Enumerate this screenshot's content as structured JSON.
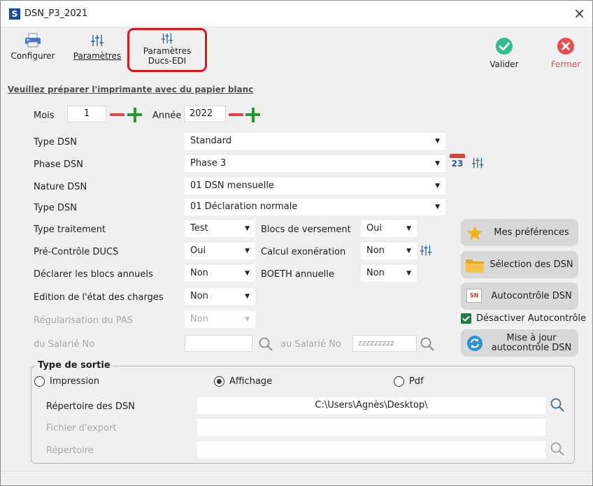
{
  "window": {
    "title": "DSN_P3_2021",
    "app_letter": "S",
    "close": "×"
  },
  "toolbar": {
    "configurer": "Configurer",
    "parametres": "Paramètres",
    "parametres_ducs_line1": "Paramètres",
    "parametres_ducs_line2": "Ducs-EDI",
    "valider": "Valider",
    "fermer": "Fermer"
  },
  "notice": "Veuillez préparer l'imprimante avec du papier blanc",
  "period": {
    "mois_label": "Mois",
    "mois": "1",
    "annee_label": "Année",
    "annee": "2022"
  },
  "fields": {
    "type_dsn_label": "Type DSN",
    "type_dsn": "Standard",
    "phase_dsn_label": "Phase DSN",
    "phase_dsn": "Phase 3",
    "calendar_day": "23",
    "nature_dsn_label": "Nature DSN",
    "nature_dsn": "01 DSN mensuelle",
    "type_dsn2_label": "Type DSN",
    "type_dsn2": "01 Déclaration normale",
    "type_traitement_label": "Type traitement",
    "type_traitement": "Test",
    "blocs_versement_label": "Blocs de versement",
    "blocs_versement": "Oui",
    "pre_controle_label": "Pré-Contrôle DUCS",
    "pre_controle": "Oui",
    "calcul_exo_label": "Calcul exonération",
    "calcul_exo": "Non",
    "blocs_annuels_label": "Déclarer les blocs annuels",
    "blocs_annuels": "Non",
    "boeth_label": "BOETH annuelle",
    "boeth": "Non",
    "edition_label": "Edition de l'état des charges",
    "edition": "Non",
    "regul_pas_label": "Régularisation du PAS",
    "regul_pas": "Non",
    "du_salarie_label": "du Salarié No",
    "du_salarie": "",
    "au_salarie_label": "au Salarié No",
    "au_salarie": "zzzzzzzzz"
  },
  "side": {
    "mes_preferences": "Mes préférences",
    "selection_dsn": "Sélection des DSN",
    "autocontrole": "Autocontrôle DSN",
    "desactiver": "Désactiver Autocontrôle",
    "maj_line1": "Mise à jour",
    "maj_line2": "autocontrôle DSN",
    "dsn_icon_text": "SN"
  },
  "sortie": {
    "title": "Type de sortie",
    "impression": "Impression",
    "affichage": "Affichage",
    "pdf": "Pdf",
    "repertoire_dsn_label": "Répertoire des DSN",
    "repertoire_dsn": "C:\\Users\\Agnès\\Desktop\\",
    "fichier_export_label": "Fichier d'export",
    "repertoire_label": "Répertoire"
  },
  "colors": {
    "accent_red": "#e0151b",
    "valid_green": "#2ebd8a",
    "close_red": "#e84c4c",
    "plus_green": "#1f9a2c",
    "minus_red": "#e64545"
  }
}
